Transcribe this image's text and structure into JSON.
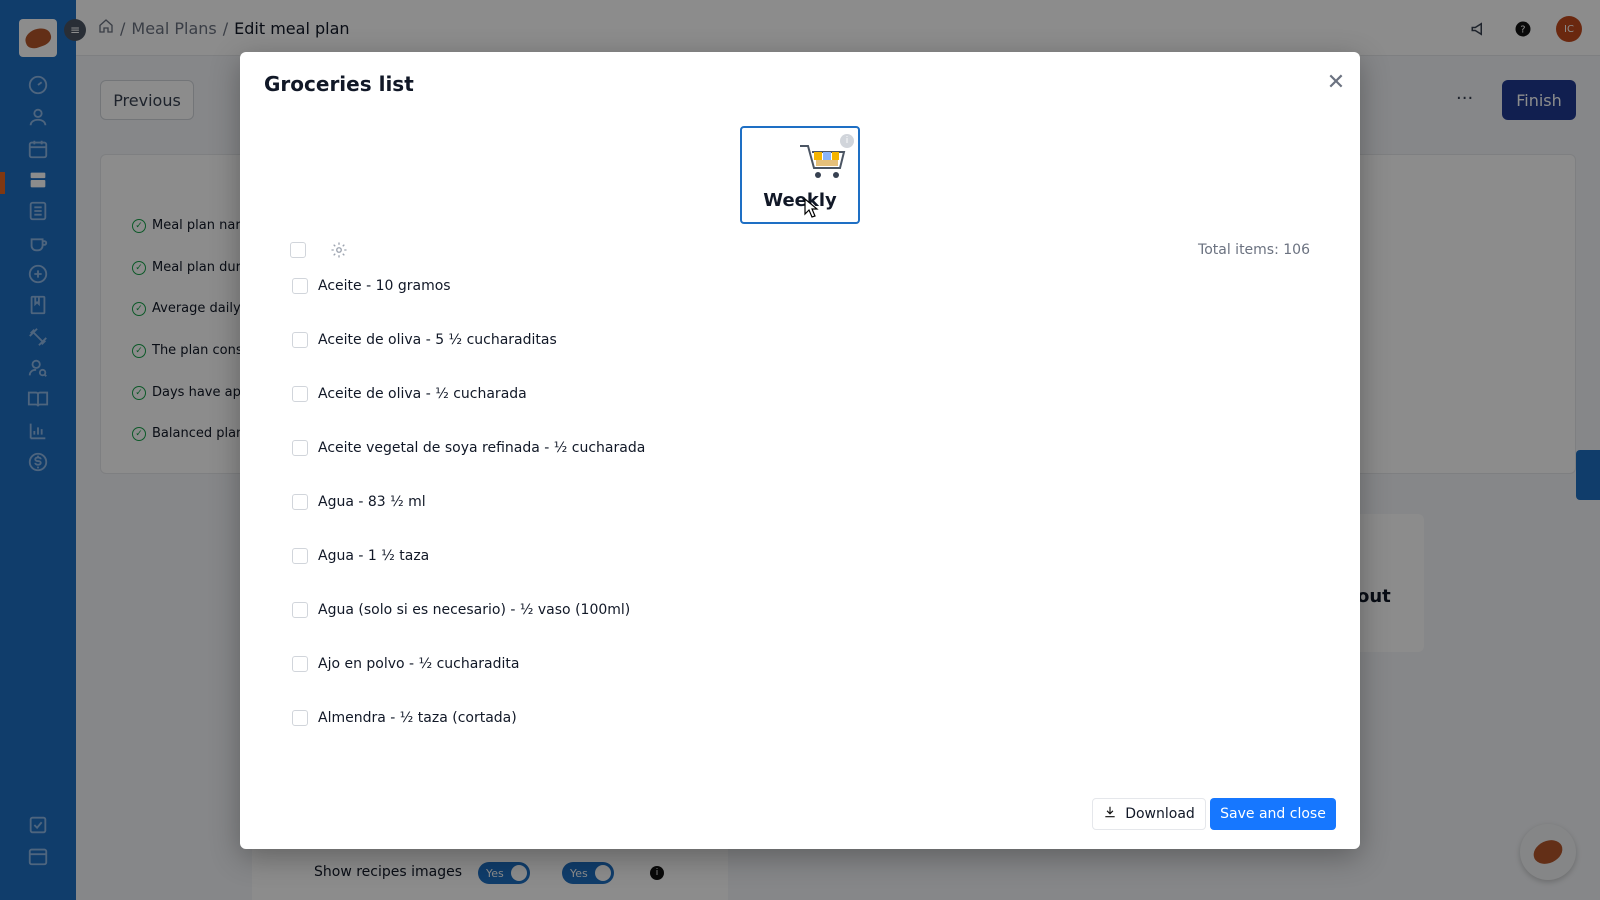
{
  "breadcrumb": {
    "home_icon": "home-icon",
    "items": [
      "Meal Plans",
      "Edit meal plan"
    ],
    "separator": "/"
  },
  "topbar": {
    "avatar_initials": "IC",
    "icons": [
      "megaphone-icon",
      "help-icon"
    ]
  },
  "page": {
    "previous_label": "Previous",
    "finish_label": "Finish",
    "more_label": "···",
    "checklist": [
      "Meal plan nar",
      "Meal plan dur",
      "Average daily",
      "The plan consi",
      "Days have app",
      "Balanced plan"
    ],
    "side_text": "out",
    "show_recipes_label": "Show recipes images",
    "toggle_labels": [
      "Yes",
      "Yes"
    ],
    "info_glyph": "i"
  },
  "modal": {
    "title": "Groceries list",
    "close_glyph": "✕",
    "weekly_label": "Weekly",
    "weekly_info_glyph": "i",
    "total_label": "Total items: 106",
    "items": [
      "Aceite - 10 gramos",
      "Aceite de oliva - 5 ½ cucharaditas",
      "Aceite de oliva - ½ cucharada",
      "Aceite vegetal de soya refinada - ½ cucharada",
      "Agua - 83 ½ ml",
      "Agua - 1 ½ taza",
      "Agua (solo si es necesario) - ½ vaso (100ml)",
      "Ajo en polvo - ½ cucharadita",
      "Almendra - ½ taza (cortada)"
    ],
    "download_label": "Download",
    "save_label": "Save and close"
  },
  "colors": {
    "sidebar": "#1e6fc4",
    "primary": "#1677ff",
    "finish": "#1f3a93",
    "accent": "#e9671f"
  }
}
